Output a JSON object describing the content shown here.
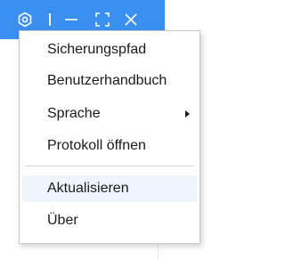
{
  "titlebar": {
    "accent_color": "#3b8ff0",
    "buttons": [
      {
        "icon": "gear-icon"
      },
      {
        "icon": "minimize-icon"
      },
      {
        "icon": "maximize-icon"
      },
      {
        "icon": "close-icon"
      }
    ]
  },
  "menu": {
    "items": [
      {
        "label": "Sicherungspfad"
      },
      {
        "label": "Benutzerhandbuch"
      },
      {
        "label": "Sprache",
        "has_submenu": true
      },
      {
        "label": "Protokoll öffnen"
      },
      {
        "label": "Aktualisieren",
        "highlighted": true
      },
      {
        "label": "Über"
      }
    ]
  }
}
